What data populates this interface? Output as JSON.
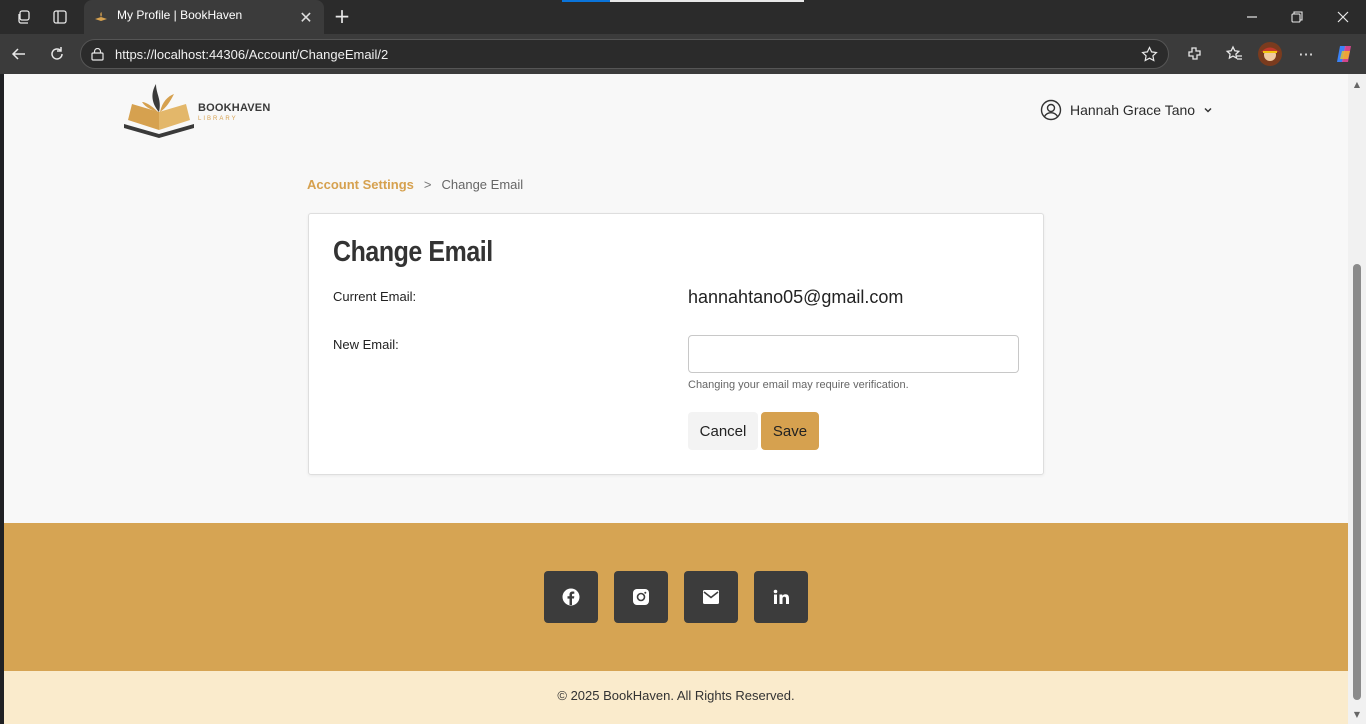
{
  "browser": {
    "tab_title": "My Profile | BookHaven",
    "url": "https://localhost:44306/Account/ChangeEmail/2"
  },
  "header": {
    "logo_name": "BOOKHAVEN",
    "logo_sub": "LIBRARY",
    "user_name": "Hannah Grace Tano"
  },
  "breadcrumb": {
    "parent": "Account Settings",
    "separator": ">",
    "current": "Change Email"
  },
  "form": {
    "title": "Change Email",
    "current_label": "Current Email:",
    "current_value": "hannahtano05@gmail.com",
    "new_label": "New Email:",
    "new_value": "",
    "hint": "Changing your email may require verification.",
    "cancel_label": "Cancel",
    "save_label": "Save"
  },
  "footer": {
    "social": [
      "facebook-icon",
      "instagram-icon",
      "mail-icon",
      "linkedin-icon"
    ],
    "copyright": "© 2025 BookHaven. All Rights Reserved."
  },
  "colors": {
    "accent": "#d6a14f",
    "footer": "#d6a453",
    "footer_bottom": "#faebcc",
    "social_bg": "#3c3c3c"
  }
}
